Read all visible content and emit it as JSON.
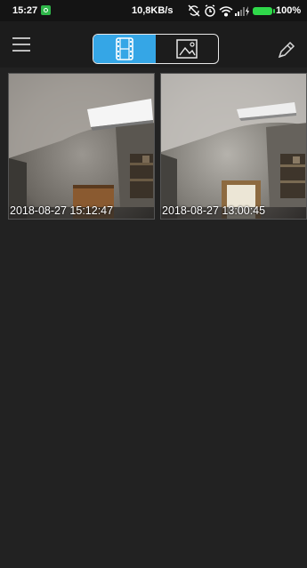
{
  "status_bar": {
    "time": "15:27",
    "network_speed": "10,8KB/s",
    "battery_percent": "100%",
    "icons": [
      "app-notification-icon",
      "sync-off-icon",
      "alarm-icon",
      "wifi-icon",
      "signal-icon",
      "charging-icon",
      "battery-icon"
    ]
  },
  "toolbar": {
    "menu_icon": "menu-icon",
    "segments": [
      {
        "icon": "video-film-icon",
        "active": true
      },
      {
        "icon": "image-icon",
        "active": false
      }
    ],
    "edit_icon": "pencil-icon"
  },
  "media_grid": {
    "items": [
      {
        "timestamp": "2018-08-27 15:12:47",
        "type": "video"
      },
      {
        "timestamp": "2018-08-27 13:00:45",
        "type": "video"
      }
    ]
  },
  "colors": {
    "accent": "#35a6e6",
    "background": "#222222",
    "battery": "#2fd84a"
  }
}
